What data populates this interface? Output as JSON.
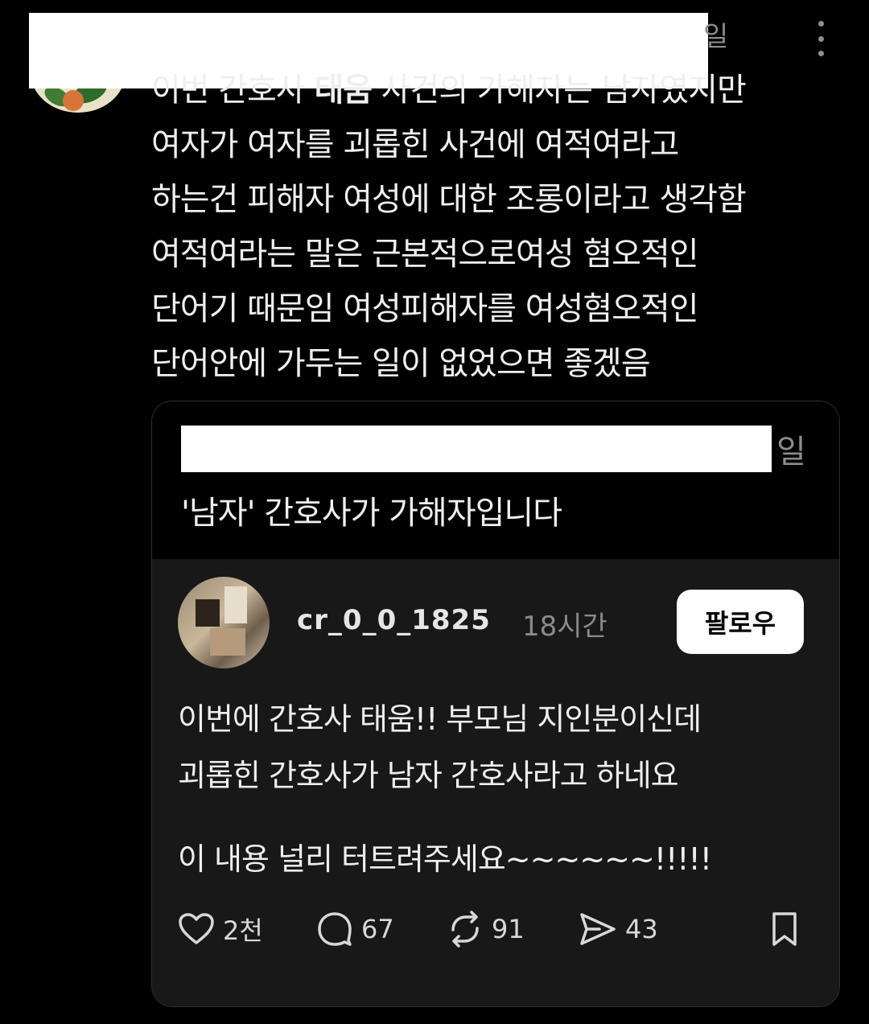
{
  "post": {
    "top_tail": "일",
    "body_lines": [
      {
        "pre": "이번 간호사 ",
        "bold": "태움",
        "post": " 사건의 가해자는 남자였지만"
      },
      {
        "text": "여자가 여자를 괴롭힌 사건에 여적여라고"
      },
      {
        "text": "하는건 피해자 여성에 대한 조롱이라고 생각함"
      },
      {
        "text": "여적여라는 말은 근본적으로여성 혐오적인"
      },
      {
        "text": "단어기 때문임 여성피해자를 여성혐오적인"
      },
      {
        "text": "단어안에 가두는 일이 없었으면 좋겠음"
      }
    ]
  },
  "quoted": {
    "header_tail": "일",
    "quote": "'남자' 간호사가 가해자입니다",
    "inner": {
      "username": "cr_0_0_1825",
      "time": "18시간",
      "follow_label": "팔로우",
      "lines": [
        "이번에 간호사 태움!! 부모님 지인분이신데",
        "괴롭힌 간호사가 남자 간호사라고 하네요",
        "이 내용 널리 터트려주세요~~~~~~!!!!!"
      ],
      "actions": {
        "likes": "2천",
        "comments": "67",
        "reposts": "91",
        "shares": "43"
      }
    }
  },
  "colors": {
    "background": "#000000",
    "card_inner": "#181818",
    "text": "#efefef",
    "muted": "#8a8a8a"
  },
  "icons": [
    "heart-icon",
    "comment-icon",
    "repost-icon",
    "share-icon",
    "bookmark-icon",
    "more-icon"
  ]
}
